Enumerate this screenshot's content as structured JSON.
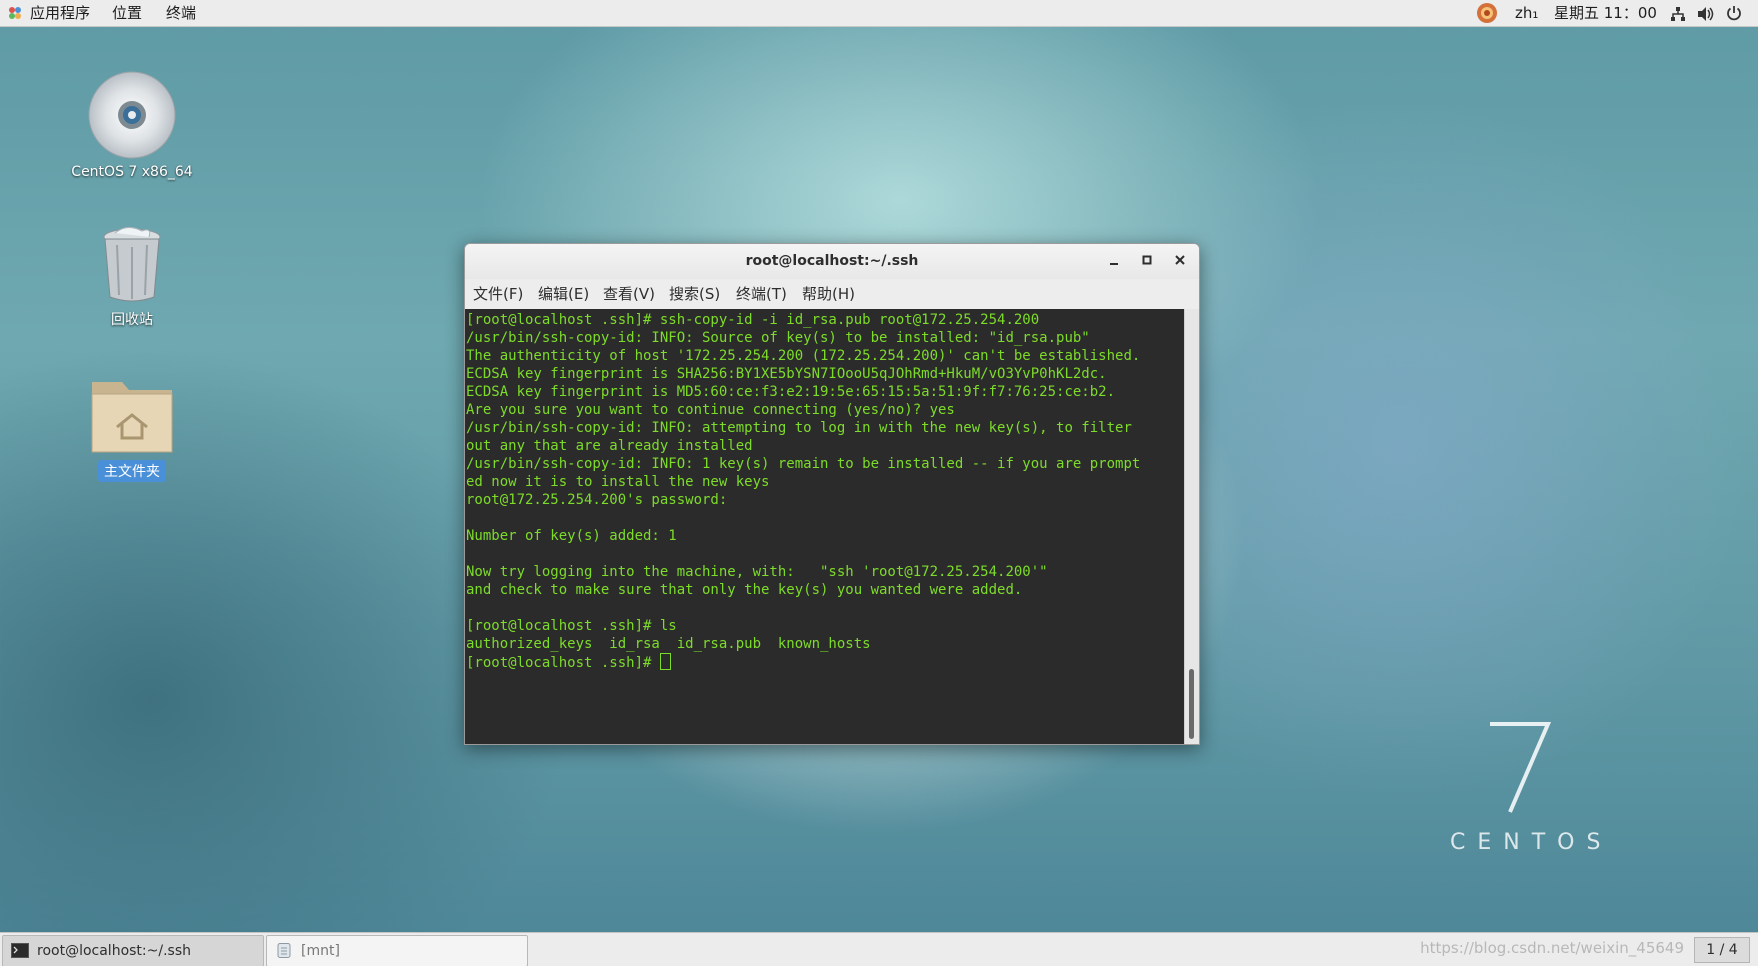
{
  "topbar": {
    "applications": "应用程序",
    "places": "位置",
    "terminal": "终端",
    "input_method": "zh₁",
    "clock": "星期五 11：00",
    "icons": [
      "fedora-icon",
      "network-icon",
      "volume-icon",
      "power-icon"
    ]
  },
  "desktop": {
    "icons": [
      {
        "label": "CentOS 7 x86_64",
        "icon": "disc-icon"
      },
      {
        "label": "回收站",
        "icon": "trash-icon"
      },
      {
        "label": "主文件夹",
        "icon": "home-folder-icon",
        "selected": true
      }
    ]
  },
  "window": {
    "title": "root@localhost:~/.ssh",
    "buttons": [
      "minimize",
      "maximize",
      "close"
    ],
    "menu": [
      "文件(F)",
      "编辑(E)",
      "查看(V)",
      "搜索(S)",
      "终端(T)",
      "帮助(H)"
    ],
    "lines": [
      "[root@localhost .ssh]# ssh-copy-id -i id_rsa.pub root@172.25.254.200",
      "/usr/bin/ssh-copy-id: INFO: Source of key(s) to be installed: \"id_rsa.pub\"",
      "The authenticity of host '172.25.254.200 (172.25.254.200)' can't be established.",
      "ECDSA key fingerprint is SHA256:BY1XE5bYSN7IOooU5qJOhRmd+HkuM/vO3YvP0hKL2dc.",
      "ECDSA key fingerprint is MD5:60:ce:f3:e2:19:5e:65:15:5a:51:9f:f7:76:25:ce:b2.",
      "Are you sure you want to continue connecting (yes/no)? yes",
      "/usr/bin/ssh-copy-id: INFO: attempting to log in with the new key(s), to filter",
      "out any that are already installed",
      "/usr/bin/ssh-copy-id: INFO: 1 key(s) remain to be installed -- if you are prompt",
      "ed now it is to install the new keys",
      "root@172.25.254.200's password:",
      "",
      "Number of key(s) added: 1",
      "",
      "Now try logging into the machine, with:   \"ssh 'root@172.25.254.200'\"",
      "and check to make sure that only the key(s) you wanted were added.",
      "",
      "[root@localhost .ssh]# ls",
      "authorized_keys  id_rsa  id_rsa.pub  known_hosts",
      "[root@localhost .ssh]# "
    ],
    "text_color": "#7ddc2a",
    "bg_color": "#2b2b2b"
  },
  "centos": {
    "seven": "7",
    "word": "CENTOS"
  },
  "taskbar": {
    "tasks": [
      {
        "label": "root@localhost:~/.ssh",
        "icon": "terminal-icon",
        "active": true
      },
      {
        "label": "[mnt]",
        "icon": "file-manager-icon",
        "active": false
      }
    ],
    "watermark": "https://blog.csdn.net/weixin_45649",
    "workspace": "1 / 4"
  }
}
